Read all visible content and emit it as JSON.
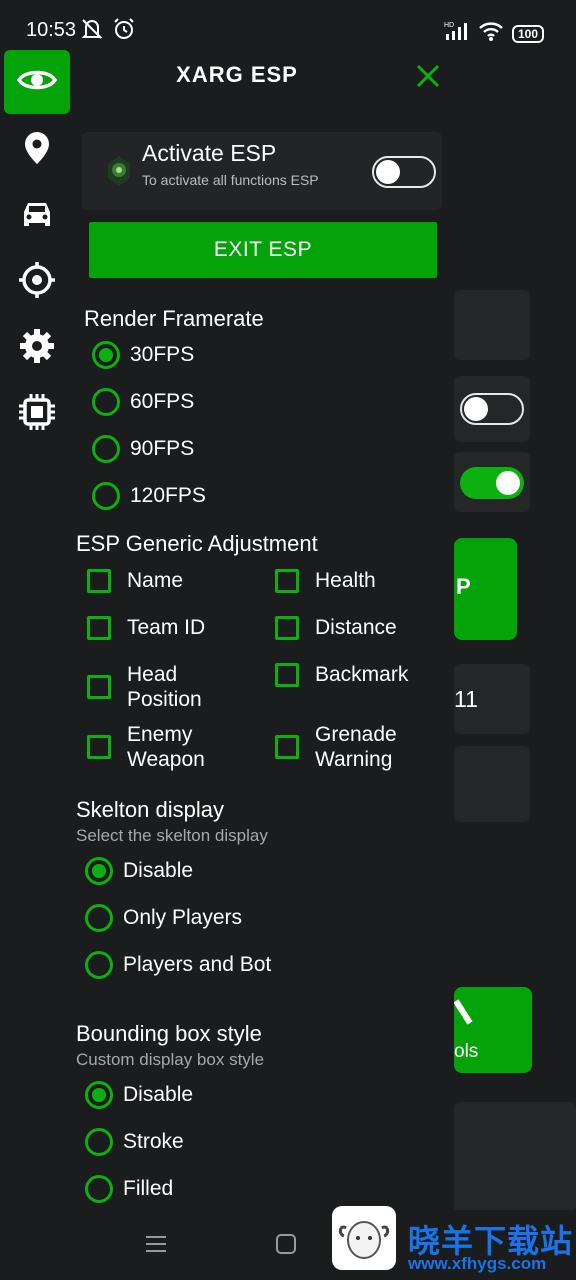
{
  "status_bar": {
    "time": "10:53",
    "battery": "100",
    "hd_label": "HD"
  },
  "header": {
    "title": "XARG ESP"
  },
  "rail": {
    "items": [
      "eye-icon",
      "location-pin-icon",
      "car-icon",
      "crosshair-icon",
      "gear-icon",
      "chip-icon"
    ]
  },
  "activate": {
    "title": "Activate ESP",
    "subtitle": "To activate all functions ESP",
    "enabled": false
  },
  "exit_button": "EXIT ESP",
  "render_framerate": {
    "title": "Render Framerate",
    "options": [
      "30FPS",
      "60FPS",
      "90FPS",
      "120FPS"
    ],
    "selected": "30FPS"
  },
  "esp_generic": {
    "title": "ESP Generic Adjustment",
    "left": [
      "Name",
      "Team ID",
      "Head Position",
      "Enemy Weapon"
    ],
    "right": [
      "Health",
      "Distance",
      "Backmark",
      "Grenade Warning"
    ]
  },
  "skelton": {
    "title": "Skelton display",
    "subtitle": "Select the skelton display",
    "options": [
      "Disable",
      "Only Players",
      "Players and Bot"
    ],
    "selected": "Disable"
  },
  "bounding_box": {
    "title": "Bounding box style",
    "subtitle": "Custom display box style",
    "options": [
      "Disable",
      "Stroke",
      "Filled"
    ],
    "selected": "Disable"
  },
  "background_app": {
    "button_text": "P",
    "card_number": "11",
    "tools_text": "ols"
  },
  "watermark": {
    "name": "晓羊下载站",
    "url": "www.xfhygs.com"
  },
  "colors": {
    "accent": "#05a30a",
    "background": "#1b1c1d"
  }
}
